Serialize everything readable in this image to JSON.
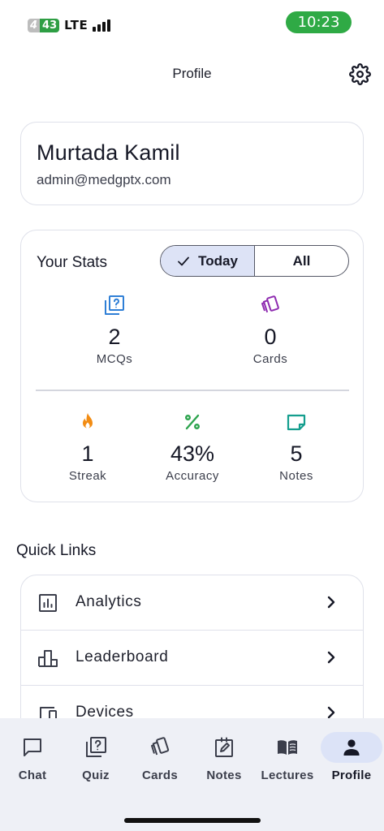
{
  "status_bar": {
    "battery_left": "4",
    "battery_right": "43",
    "network": "LTE",
    "time": "10:23"
  },
  "header": {
    "title": "Profile",
    "settings_icon": "gear-icon"
  },
  "profile": {
    "name": "Murtada Kamil",
    "email": "admin@medgptx.com"
  },
  "stats": {
    "title": "Your Stats",
    "toggle": {
      "options": [
        "Today",
        "All"
      ],
      "selected": "Today"
    },
    "items": [
      {
        "icon": "quiz-icon",
        "value": "2",
        "label": "MCQs",
        "color": "#2f7fd6"
      },
      {
        "icon": "cards-icon",
        "value": "0",
        "label": "Cards",
        "color": "#8e2bb0"
      },
      {
        "icon": "flame-icon",
        "value": "1",
        "label": "Streak",
        "color": "#f28c13"
      },
      {
        "icon": "percent-icon",
        "value": "43%",
        "label": "Accuracy",
        "color": "#2da44e"
      },
      {
        "icon": "note-icon",
        "value": "5",
        "label": "Notes",
        "color": "#149e8e"
      }
    ]
  },
  "quick_links": {
    "title": "Quick Links",
    "items": [
      {
        "label": "Analytics",
        "icon": "analytics-icon"
      },
      {
        "label": "Leaderboard",
        "icon": "leaderboard-icon"
      },
      {
        "label": "Devices",
        "icon": "devices-icon"
      }
    ]
  },
  "bottom_nav": {
    "items": [
      {
        "label": "Chat",
        "icon": "chat-icon"
      },
      {
        "label": "Quiz",
        "icon": "quiz-icon"
      },
      {
        "label": "Cards",
        "icon": "cards-icon"
      },
      {
        "label": "Notes",
        "icon": "notes-icon"
      },
      {
        "label": "Lectures",
        "icon": "book-icon"
      },
      {
        "label": "Profile",
        "icon": "person-icon"
      }
    ],
    "active": "Profile"
  }
}
